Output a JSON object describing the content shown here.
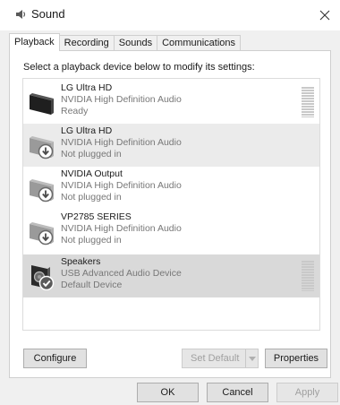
{
  "window": {
    "title": "Sound"
  },
  "tabs": [
    {
      "label": "Playback",
      "active": true
    },
    {
      "label": "Recording"
    },
    {
      "label": "Sounds"
    },
    {
      "label": "Communications"
    }
  ],
  "instruction": "Select a playback device below to modify its settings:",
  "devices": [
    {
      "name": "LG Ultra HD",
      "driver": "NVIDIA High Definition Audio",
      "status": "Ready",
      "icon": "monitor-icon",
      "state": "normal",
      "level_meter": true
    },
    {
      "name": "LG Ultra HD",
      "driver": "NVIDIA High Definition Audio",
      "status": "Not plugged in",
      "icon": "monitor-icon",
      "state": "unplugged",
      "level_meter": false
    },
    {
      "name": "NVIDIA Output",
      "driver": "NVIDIA High Definition Audio",
      "status": "Not plugged in",
      "icon": "monitor-icon",
      "state": "unplugged",
      "level_meter": false
    },
    {
      "name": "VP2785 SERIES",
      "driver": "NVIDIA High Definition Audio",
      "status": "Not plugged in",
      "icon": "monitor-icon",
      "state": "unplugged",
      "level_meter": false
    },
    {
      "name": "Speakers",
      "driver": "USB Advanced Audio Device",
      "status": "Default Device",
      "icon": "speaker-icon",
      "state": "default",
      "selected": true,
      "level_meter": true
    }
  ],
  "buttons": {
    "configure": "Configure",
    "set_default": "Set Default",
    "properties": "Properties",
    "ok": "OK",
    "cancel": "Cancel",
    "apply": "Apply"
  },
  "colors": {
    "selected_row": "#d9d9d9",
    "greyed_row": "#ebebeb",
    "status_badge_green": "#4a4a4a"
  }
}
